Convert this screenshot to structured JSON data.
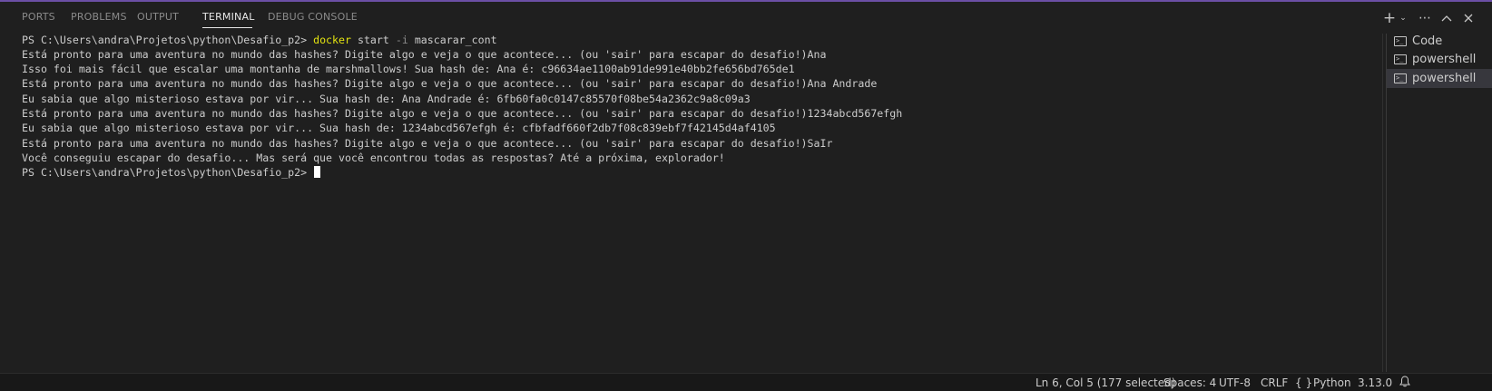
{
  "tabs": [
    {
      "label": "PORTS",
      "active": false
    },
    {
      "label": "PROBLEMS",
      "active": false
    },
    {
      "label": "OUTPUT",
      "active": false
    },
    {
      "label": "TERMINAL",
      "active": true
    },
    {
      "label": "DEBUG CONSOLE",
      "active": false
    }
  ],
  "actions": {
    "new_terminal_icon": "plus-icon",
    "launch_profile_icon": "chevron-down-icon",
    "more_icon": "ellipsis-icon",
    "maximize_icon": "chevron-up-icon",
    "close_icon": "close-icon"
  },
  "terminal": {
    "prompt": "PS C:\\Users\\andra\\Projetos\\python\\Desafio_p2>",
    "command": "docker",
    "command_args_1": "start",
    "command_flag": "-i",
    "command_args_2": "mascarar_cont",
    "output": [
      "Está pronto para uma aventura no mundo das hashes? Digite algo e veja o que acontece... (ou 'sair' para escapar do desafio!)Ana",
      "Isso foi mais fácil que escalar uma montanha de marshmallows! Sua hash de: Ana é: c96634ae1100ab91de991e40bb2fe656bd765de1",
      "Está pronto para uma aventura no mundo das hashes? Digite algo e veja o que acontece... (ou 'sair' para escapar do desafio!)Ana Andrade",
      "Eu sabia que algo misterioso estava por vir... Sua hash de: Ana Andrade é: 6fb60fa0c0147c85570f08be54a2362c9a8c09a3",
      "Está pronto para uma aventura no mundo das hashes? Digite algo e veja o que acontece... (ou 'sair' para escapar do desafio!)1234abcd567efgh",
      "Eu sabia que algo misterioso estava por vir... Sua hash de: 1234abcd567efgh é: cfbfadf660f2db7f08c839ebf7f42145d4af4105",
      "Está pronto para uma aventura no mundo das hashes? Digite algo e veja o que acontece... (ou 'sair' para escapar do desafio!)SaIr",
      "Você conseguiu escapar do desafio... Mas será que você encontrou todas as respostas? Até a próxima, explorador!"
    ],
    "final_prompt": "PS C:\\Users\\andra\\Projetos\\python\\Desafio_p2>"
  },
  "terminal_list": [
    {
      "label": "Code",
      "icon": "terminal-icon",
      "active": false
    },
    {
      "label": "powershell",
      "icon": "terminal-icon",
      "active": false
    },
    {
      "label": "powershell",
      "icon": "terminal-icon",
      "active": true
    }
  ],
  "statusbar": {
    "cursor": "Ln 6, Col 5 (177 selected)",
    "spaces": "Spaces: 4",
    "encoding": "UTF-8",
    "eol": "CRLF",
    "language_icon": "{ }",
    "language": "Python",
    "version": "3.13.0",
    "bell_icon": "bell-icon"
  }
}
